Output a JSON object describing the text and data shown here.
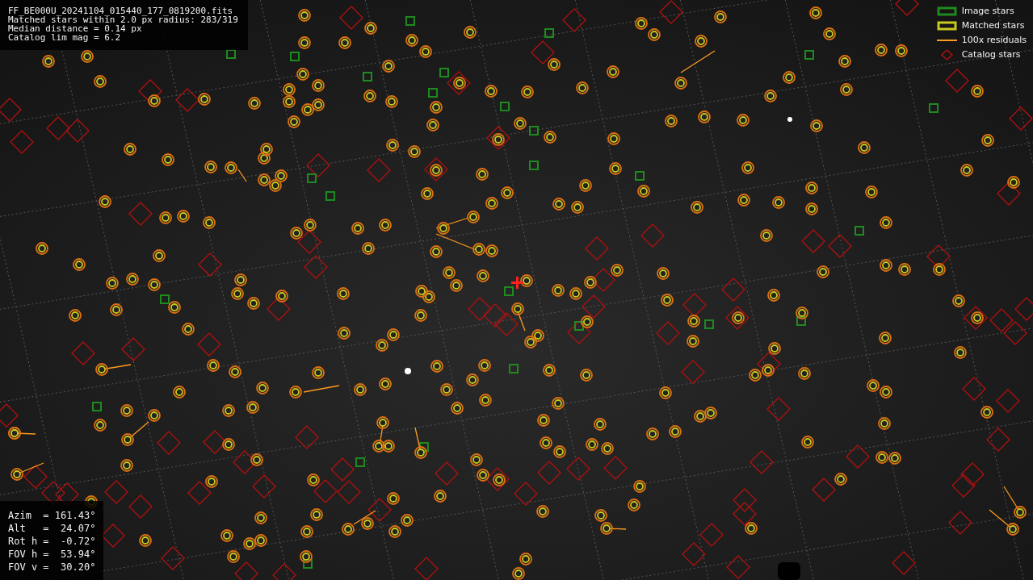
{
  "info_lines": [
    "FF_BE000U_20241104_015440_177_0819200.fits",
    "Matched stars within 2.0 px radius: 283/319",
    "Median distance = 0.14 px",
    "Catalog lim mag = 6.2"
  ],
  "legend": [
    {
      "kind": "box",
      "color": "#1f8a1f",
      "label": "Image stars"
    },
    {
      "kind": "box",
      "color": "#c8c81e",
      "label": "Matched stars"
    },
    {
      "kind": "line",
      "color": "#ff9a1e",
      "label": "100x residuals"
    },
    {
      "kind": "diamond",
      "color": "#b01010",
      "label": "Catalog stars"
    }
  ],
  "pointing_lines": [
    "Azim  = 161.43°",
    "Alt   =  24.07°",
    "Rot h =  -0.72°",
    "FOV h =  53.94°",
    "FOV v =  30.20°"
  ]
}
